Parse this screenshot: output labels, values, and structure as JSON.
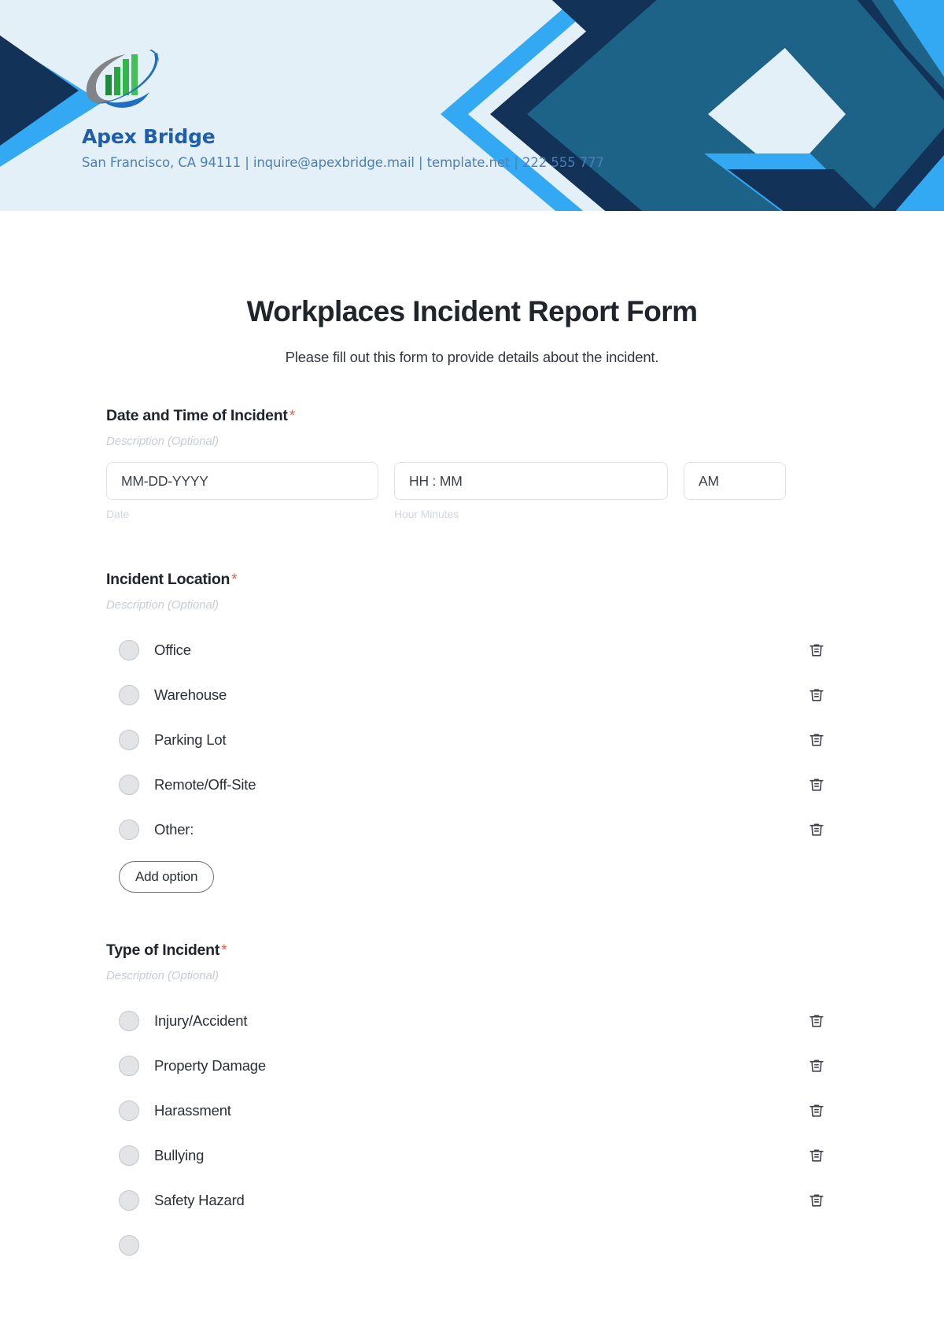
{
  "brand": {
    "name": "Apex Bridge",
    "contact": "San Francisco, CA 94111 | inquire@apexbridge.mail | template.net | 222 555 777",
    "logo_icon": "bar-chart-swoosh-logo",
    "name_color": "#1f5fa9",
    "contact_color": "#4d7fb5",
    "banner_bg": "#e3f0f7",
    "banner_colors": {
      "navy": "#123257",
      "bright_blue": "#32a9f2",
      "steel_blue": "#1d6287",
      "pale": "#e3f0f7"
    }
  },
  "form": {
    "title": "Workplaces Incident Report Form",
    "subtitle": "Please fill out this form to provide details about the incident.",
    "required_marker": "*",
    "required_color": "#fa5a3c",
    "description_placeholder": "Description (Optional)",
    "add_option_label": "Add option",
    "delete_icon": "trash-icon",
    "radio_icon": "radio-unselected-icon"
  },
  "fields": [
    {
      "label": "Date and Time of Incident",
      "required": true,
      "description": "Description (Optional)",
      "type": "datetime",
      "inputs": [
        {
          "name": "date",
          "placeholder": "MM-DD-YYYY",
          "sublabel": "Date"
        },
        {
          "name": "time",
          "placeholder": "HH : MM",
          "sublabel": "Hour Minutes"
        },
        {
          "name": "ampm",
          "placeholder": "AM",
          "sublabel": ""
        }
      ]
    },
    {
      "label": "Incident Location",
      "required": true,
      "description": "Description (Optional)",
      "type": "radio",
      "options": [
        "Office",
        "Warehouse",
        "Parking Lot",
        "Remote/Off-Site",
        "Other:"
      ],
      "add_option_label": "Add option"
    },
    {
      "label": "Type of Incident",
      "required": true,
      "description": "Description (Optional)",
      "type": "radio",
      "options": [
        "Injury/Accident",
        "Property Damage",
        "Harassment",
        "Bullying",
        "Safety Hazard"
      ]
    }
  ]
}
